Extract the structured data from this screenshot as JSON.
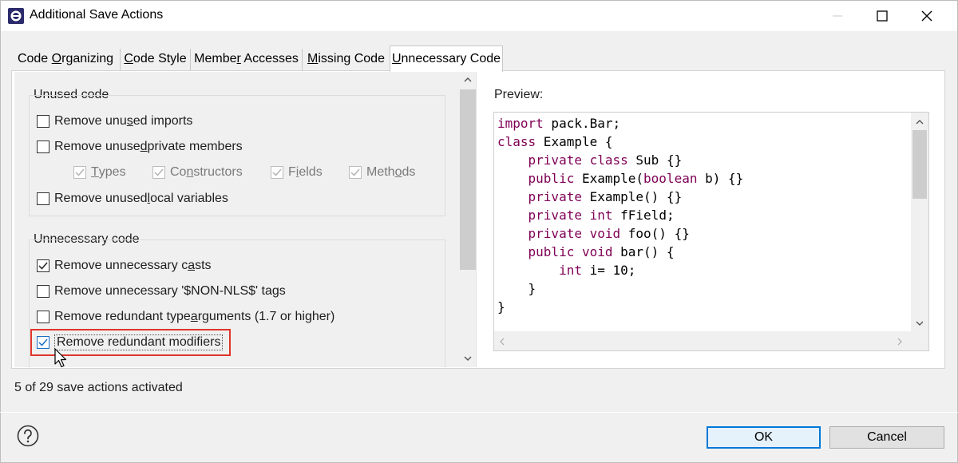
{
  "window": {
    "title": "Additional Save Actions",
    "icons": [
      "app-icon",
      "minimize-icon",
      "maximize-icon",
      "close-icon"
    ]
  },
  "tabs": [
    {
      "pre": "Code ",
      "u": "O",
      "post": "rganizing"
    },
    {
      "pre": "",
      "u": "C",
      "post": "ode Style"
    },
    {
      "pre": "Membe",
      "u": "r",
      "post": " Accesses"
    },
    {
      "pre": "",
      "u": "M",
      "post": "issing Code"
    },
    {
      "pre": "",
      "u": "U",
      "post": "nnecessary Code"
    }
  ],
  "active_tab": "Unnecessary Code",
  "unused_code": {
    "title": "Unused code",
    "remove_imports": {
      "pre": "Remove unu",
      "u": "s",
      "post": "ed imports",
      "checked": false
    },
    "remove_private": {
      "pre": "Remove unuse",
      "u": "d",
      "post": " private members",
      "checked": false
    },
    "types": {
      "pre": "",
      "u": "T",
      "post": "ypes",
      "checked": true,
      "enabled": false
    },
    "constructors": {
      "pre": "Co",
      "u": "n",
      "post": "structors",
      "checked": true,
      "enabled": false
    },
    "fields": {
      "pre": "F",
      "u": "i",
      "post": "elds",
      "checked": true,
      "enabled": false
    },
    "methods": {
      "pre": "Meth",
      "u": "o",
      "post": "ds",
      "checked": true,
      "enabled": false
    },
    "remove_locals": {
      "pre": "Remove unused ",
      "u": "l",
      "post": "ocal variables",
      "checked": false
    }
  },
  "unnecessary_code": {
    "title": "Unnecessary code",
    "casts": {
      "pre": "Remove unnecessary c",
      "u": "a",
      "post": "sts",
      "checked": true
    },
    "nls": {
      "pre": "Remove unnecessary '$NON-NLS$' tags",
      "u": "",
      "post": "",
      "checked": false
    },
    "type_args": {
      "pre": "Remove redundant type ",
      "u": "a",
      "post": "rguments (1.7 or higher)",
      "checked": false
    },
    "modifiers": {
      "pre": "Remove redundant modifiers",
      "u": "",
      "post": "",
      "checked": true,
      "focused": true
    }
  },
  "preview": {
    "label": "Preview:",
    "code_lines": [
      [
        {
          "t": "import",
          "kw": true
        },
        {
          "t": " pack.Bar;"
        }
      ],
      [
        {
          "t": "class",
          "kw": true
        },
        {
          "t": " Example {"
        }
      ],
      [
        {
          "t": "    "
        },
        {
          "t": "private",
          "kw": true
        },
        {
          "t": " "
        },
        {
          "t": "class",
          "kw": true
        },
        {
          "t": " Sub {}"
        }
      ],
      [
        {
          "t": "    "
        },
        {
          "t": "public",
          "kw": true
        },
        {
          "t": " Example("
        },
        {
          "t": "boolean",
          "kw": true
        },
        {
          "t": " b) {}"
        }
      ],
      [
        {
          "t": "    "
        },
        {
          "t": "private",
          "kw": true
        },
        {
          "t": " Example() {}"
        }
      ],
      [
        {
          "t": "    "
        },
        {
          "t": "private",
          "kw": true
        },
        {
          "t": " "
        },
        {
          "t": "int",
          "kw": true
        },
        {
          "t": " fField;"
        }
      ],
      [
        {
          "t": "    "
        },
        {
          "t": "private",
          "kw": true
        },
        {
          "t": " "
        },
        {
          "t": "void",
          "kw": true
        },
        {
          "t": " foo() {}"
        }
      ],
      [
        {
          "t": "    "
        },
        {
          "t": "public",
          "kw": true
        },
        {
          "t": " "
        },
        {
          "t": "void",
          "kw": true
        },
        {
          "t": " bar() {"
        }
      ],
      [
        {
          "t": "        "
        },
        {
          "t": "int",
          "kw": true
        },
        {
          "t": " i= 10;"
        }
      ],
      [
        {
          "t": "    }"
        }
      ],
      [
        {
          "t": "}"
        }
      ]
    ]
  },
  "status": "5 of 29 save actions activated",
  "buttons": {
    "ok": "OK",
    "cancel": "Cancel"
  },
  "colors": {
    "keyword": "#7f0055",
    "highlight": "#e0352b",
    "accent": "#0078d7"
  }
}
